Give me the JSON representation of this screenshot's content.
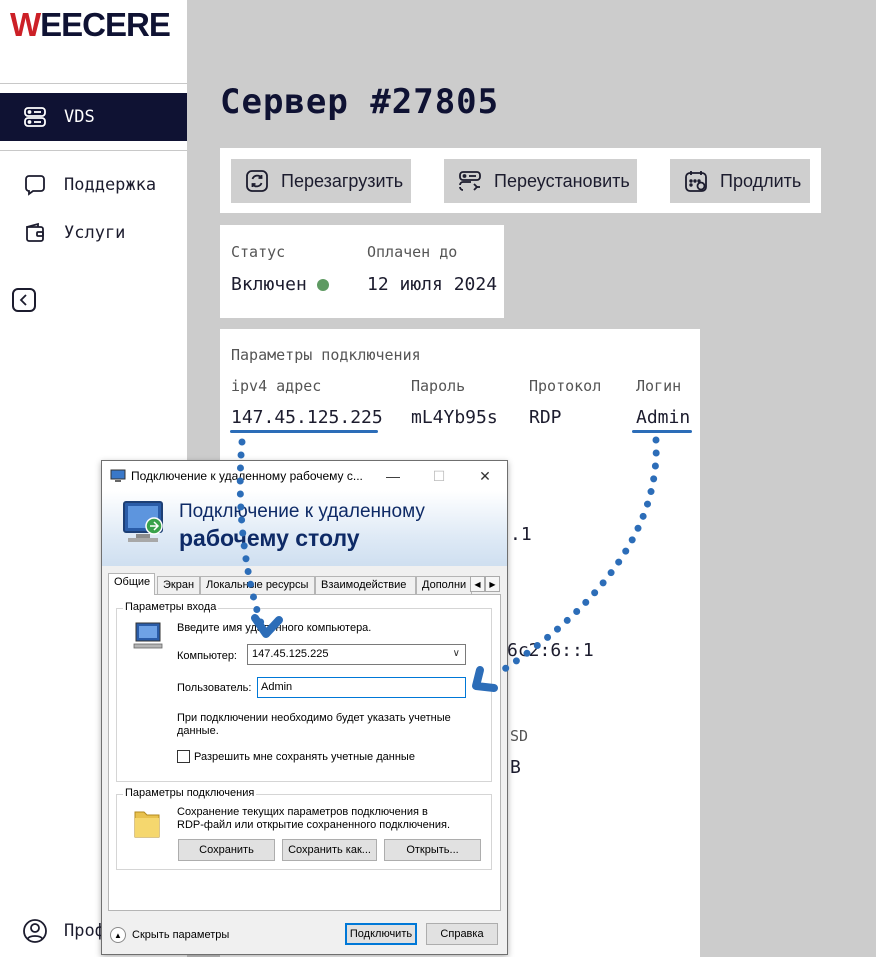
{
  "brand": {
    "logo_first": "W",
    "logo_rest": "EECERE"
  },
  "sidebar": {
    "items": [
      {
        "label": "VDS",
        "icon": "server-icon"
      },
      {
        "label": "Поддержка",
        "icon": "chat-bubble-icon"
      },
      {
        "label": "Услуги",
        "icon": "wallet-icon"
      }
    ],
    "profile_label": "Проф"
  },
  "page": {
    "title": "Сервер #27805"
  },
  "actions": {
    "reboot": "Перезагрузить",
    "reinstall": "Переустановить",
    "extend": "Продлить"
  },
  "status": {
    "status_label": "Статус",
    "status_value": "Включен",
    "status_color": "#5e9a62",
    "paid_label": "Оплачен до",
    "paid_value": "12 июля 2024"
  },
  "connection": {
    "section_label": "Параметры подключения",
    "ipv4_label": "ipv4 адрес",
    "ipv4_value": "147.45.125.225",
    "password_label": "Пароль",
    "password_value": "mL4Yb95s",
    "protocol_label": "Протокол",
    "protocol_value": "RDP",
    "login_label": "Логин",
    "login_value": "Admin",
    "partial_1": ".1",
    "partial_2": "6c2:6::1",
    "partial_3": "SD",
    "partial_4": "B"
  },
  "rdp": {
    "window_title": "Подключение к удаленному рабочему с...",
    "banner_line1": "Подключение к удаленному",
    "banner_line2": "рабочему столу",
    "tabs": [
      "Общие",
      "Экран",
      "Локальные ресурсы",
      "Взаимодействие",
      "Дополни"
    ],
    "login_group": "Параметры входа",
    "hint": "Введите имя удаленного компьютера.",
    "computer_label": "Компьютер:",
    "computer_value": "147.45.125.225",
    "user_label": "Пользователь:",
    "user_value": "Admin",
    "credentials_note_1": "При подключении необходимо будет указать учетные",
    "credentials_note_2": "данные.",
    "save_creds_label": "Разрешить мне сохранять учетные данные",
    "conn_group": "Параметры подключения",
    "conn_note_1": "Сохранение текущих параметров подключения в",
    "conn_note_2": "RDP-файл или открытие сохраненного подключения.",
    "save_btn": "Сохранить",
    "save_as_btn": "Сохранить как...",
    "open_btn": "Открыть...",
    "hide_params": "Скрыть параметры",
    "connect_btn": "Подключить",
    "help_btn": "Справка"
  },
  "colors": {
    "navy": "#0f1233",
    "brand_red": "#cc2027",
    "annotation_blue": "#2c6db8",
    "background_gray": "#cccccc"
  }
}
